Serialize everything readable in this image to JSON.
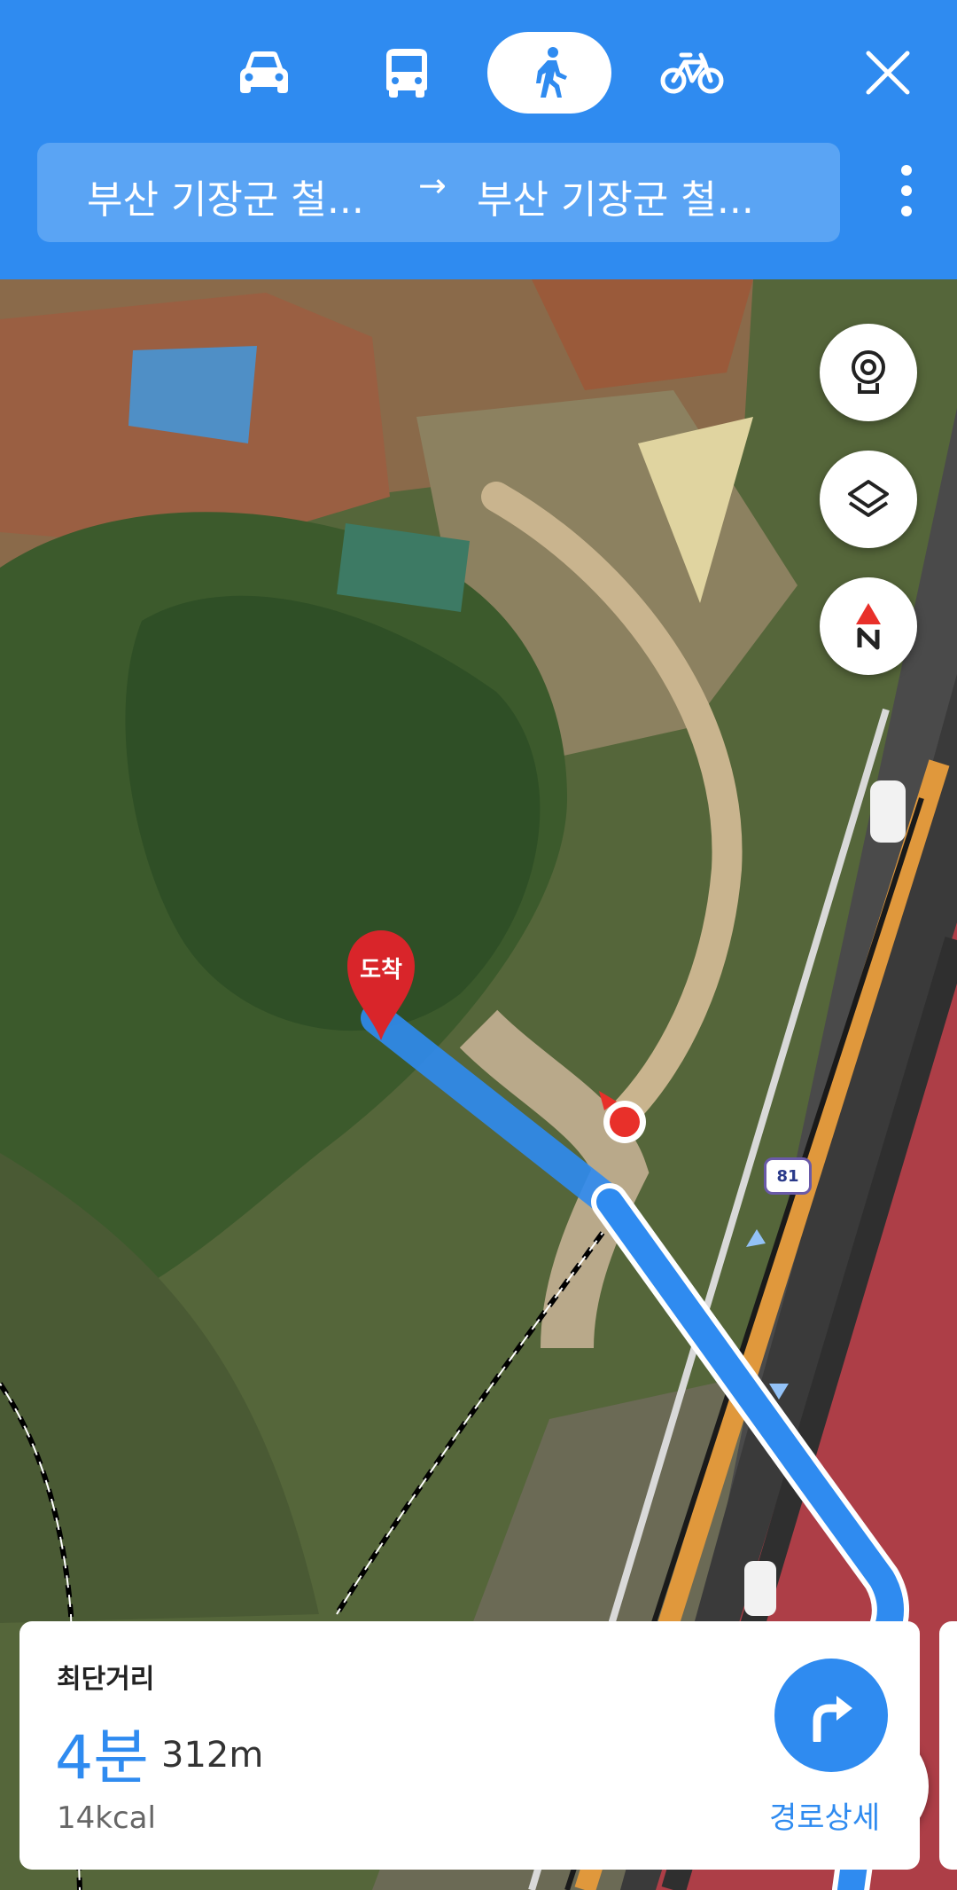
{
  "modes": [
    {
      "name": "car",
      "icon": "car-icon",
      "active": false
    },
    {
      "name": "bus",
      "icon": "bus-icon",
      "active": false
    },
    {
      "name": "walk",
      "icon": "walk-icon",
      "active": true
    },
    {
      "name": "bike",
      "icon": "bike-icon",
      "active": false
    }
  ],
  "route": {
    "origin": "부산 기장군 철...",
    "arrow": "→",
    "destination": "부산 기장군 철..."
  },
  "map": {
    "pin_label": "도착",
    "road_shield": "81",
    "buttons": [
      "cctv-icon",
      "layers-icon",
      "compass-icon",
      "my-location-icon"
    ]
  },
  "summary": {
    "type_label": "최단거리",
    "time": "4분",
    "distance": "312m",
    "calories": "14kcal",
    "detail_label": "경로상세"
  },
  "colors": {
    "accent": "#2f8bf0",
    "pin": "#d9252a"
  }
}
